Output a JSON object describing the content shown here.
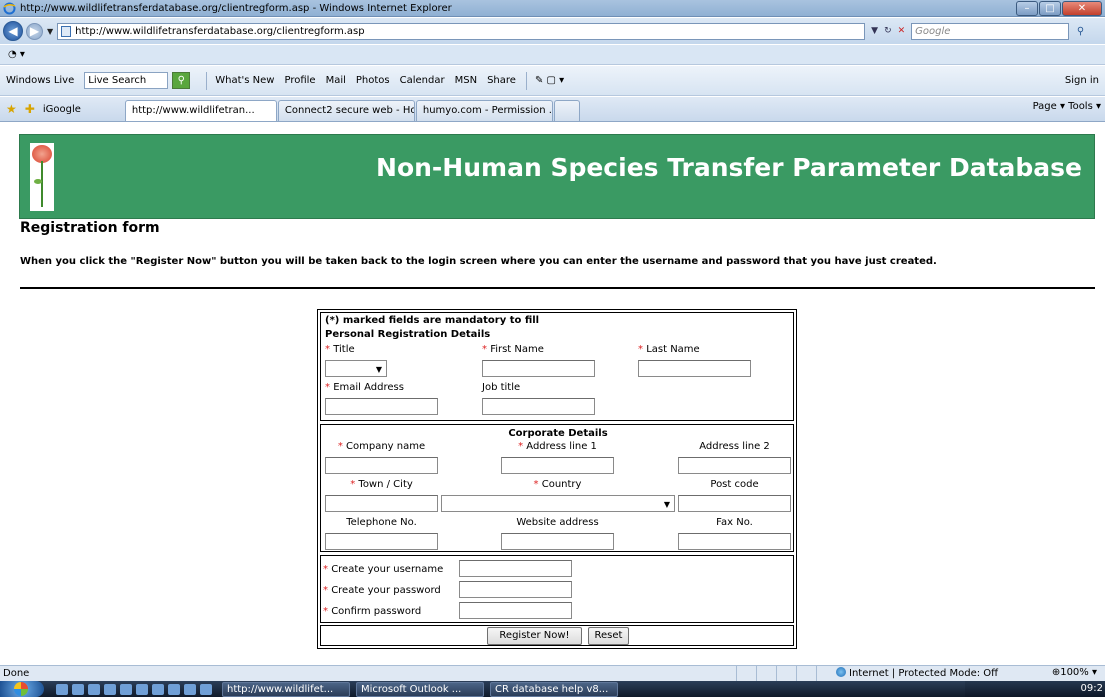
{
  "browser": {
    "window_title": "http://www.wildlifetransferdatabase.org/clientregform.asp - Windows Internet Explorer",
    "url": "http://www.wildlifetransferdatabase.org/clientregform.asp",
    "search_placeholder": "Google",
    "toolbar": {
      "brand": "Windows Live",
      "live_search": "Live Search",
      "links": [
        "What's New",
        "Profile",
        "Mail",
        "Photos",
        "Calendar",
        "MSN",
        "Share"
      ],
      "sign_in": "Sign in"
    },
    "favorites_item": "iGoogle",
    "tabs": [
      "http://www.wildlifetran...",
      "Connect2 secure web - Ho...",
      "humyo.com - Permission ..."
    ],
    "command_bar": "Page ▾  Tools ▾",
    "status_text": "Done",
    "zone_text": "Internet | Protected Mode: Off",
    "zoom": "100%"
  },
  "taskbar": {
    "tasks": [
      "http://www.wildlifet...",
      "Microsoft Outlook ...",
      "CR database help v8..."
    ],
    "clock": "09:2"
  },
  "page": {
    "banner_title": "Non-Human Species Transfer Parameter Database",
    "heading": "Registration form",
    "instructions": "When you click the \"Register Now\" button you will be taken back to the login screen where you can enter the username and password that you have just created.",
    "mandatory_note": "marked fields are mandatory to fill",
    "mandatory_mark": "(*)",
    "personal": {
      "title": "Personal Registration Details",
      "title_label": "Title",
      "first_name_label": "First Name",
      "last_name_label": "Last Name",
      "email_label": "Email Address",
      "job_title_label": "Job title"
    },
    "corporate": {
      "title": "Corporate Details",
      "company_label": "Company name",
      "address1_label": "Address line 1",
      "address2_label": "Address line 2",
      "town_label": "Town / City",
      "country_label": "Country",
      "postcode_label": "Post code",
      "telephone_label": "Telephone No.",
      "website_label": "Website address",
      "fax_label": "Fax No."
    },
    "account": {
      "username_label": "Create your username",
      "password_label": "Create your password",
      "confirm_label": "Confirm password"
    },
    "buttons": {
      "register": "Register Now!",
      "reset": "Reset"
    },
    "required_star": "*"
  }
}
